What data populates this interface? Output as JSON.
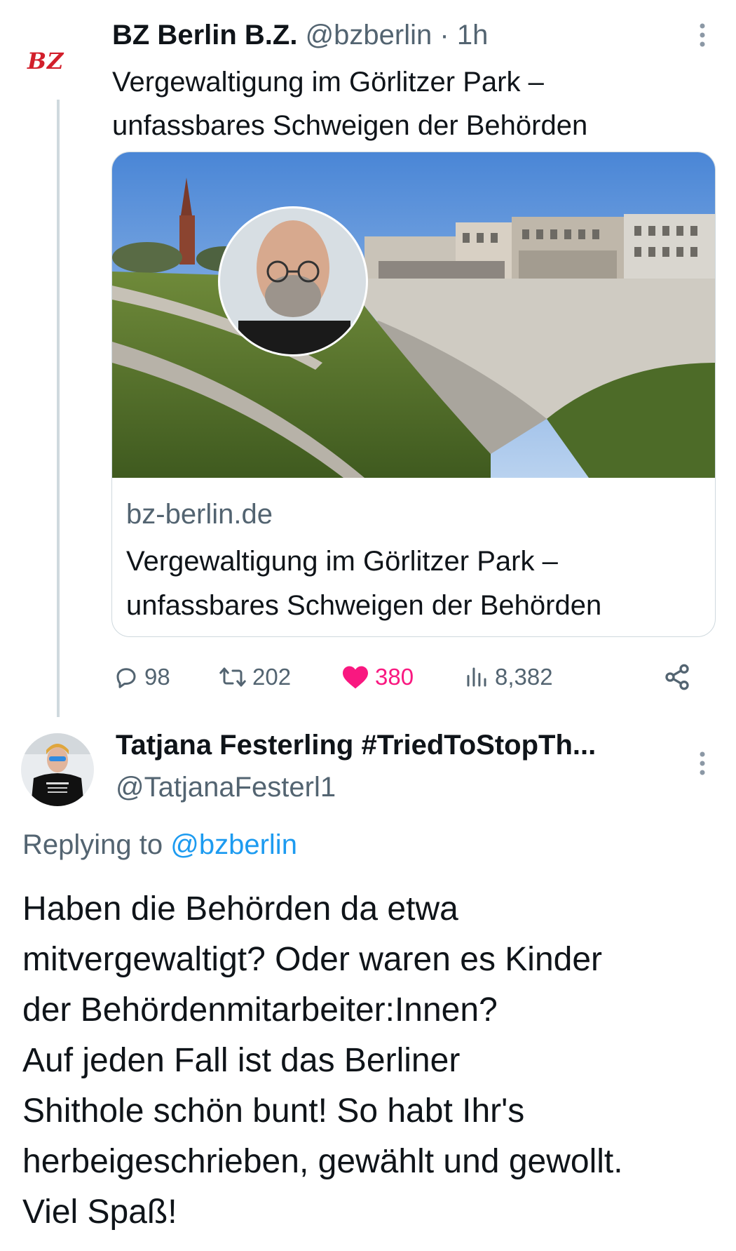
{
  "tweet1": {
    "logo_text": "BZ",
    "display_name": "BZ Berlin B.Z.",
    "handle": "@bzberlin",
    "separator": "·",
    "time": "1h",
    "text": "Vergewaltigung im Görlitzer Park – unfassbares Schweigen der Behörden",
    "card": {
      "domain": "bz-berlin.de",
      "title": "Vergewaltigung im Görlitzer Park – unfassbares Schweigen der Behörden"
    },
    "stats": {
      "replies": "98",
      "retweets": "202",
      "likes": "380",
      "views": "8,382"
    },
    "like_color": "#f91880"
  },
  "tweet2": {
    "display_name": "Tatjana Festerling #TriedToStopTh...",
    "handle": "@TatjanaFesterl1",
    "replying_prefix": "Replying to",
    "replying_to": "@bzberlin",
    "body_lines": [
      "Haben die Behörden da etwa",
      "mitvergewaltigt? Oder waren es Kinder",
      "der Behördenmitarbeiter:Innen?",
      "Auf jeden Fall ist das Berliner",
      "Shithole schön bunt! So habt Ihr's",
      "herbeigeschrieben, gewählt und gewollt.",
      "Viel Spaß!"
    ]
  },
  "icons": {
    "reply": "reply-icon",
    "retweet": "retweet-icon",
    "like": "heart-icon",
    "views": "views-icon",
    "share": "share-icon",
    "more": "more-icon"
  },
  "colors": {
    "link": "#1d9bf0",
    "muted": "#536471",
    "brand_bz": "#d21f2b"
  }
}
